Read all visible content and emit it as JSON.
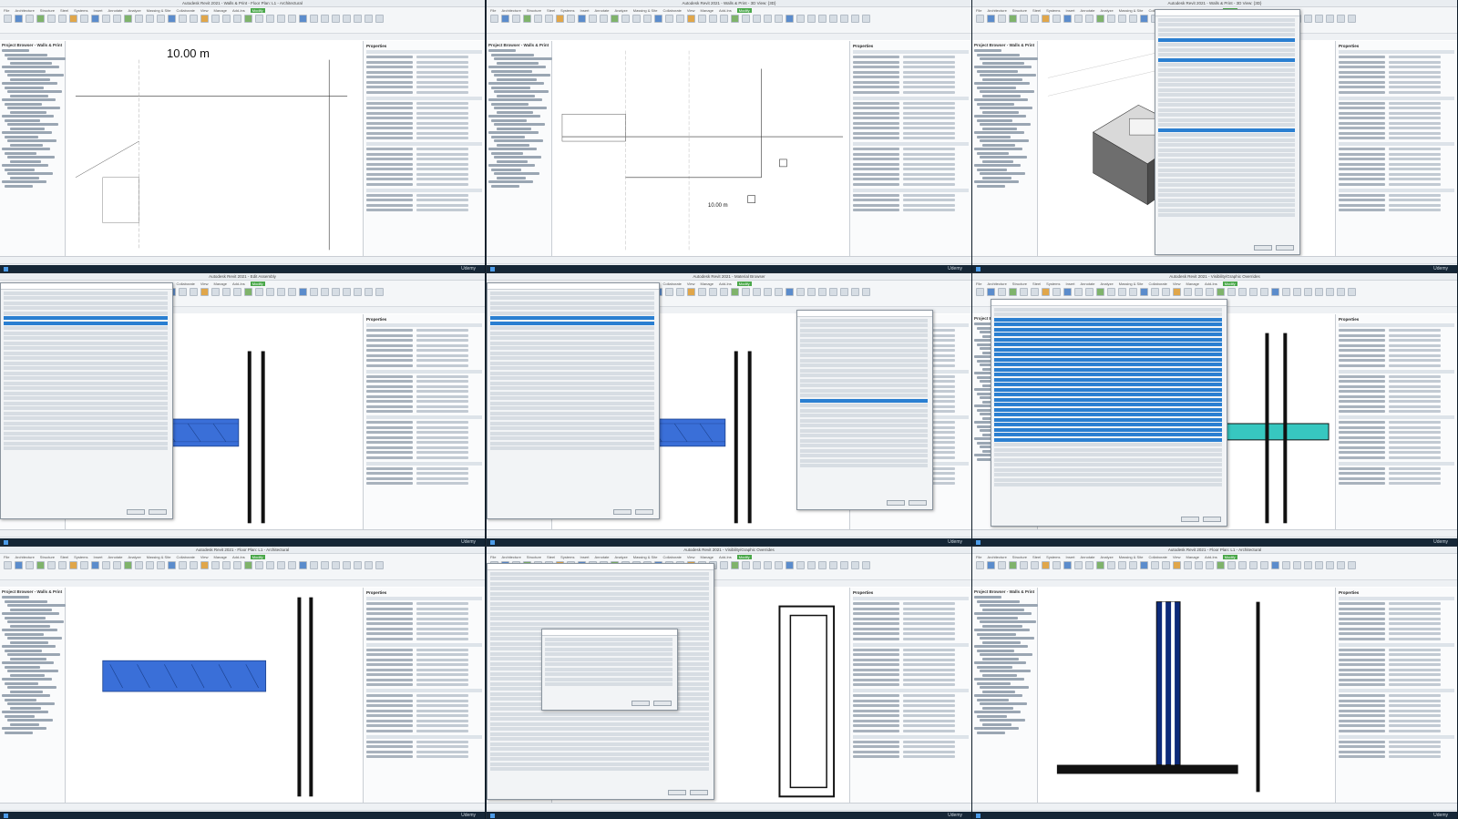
{
  "grid": {
    "cells": [
      {
        "title": "Autodesk Revit 2021 - Walls & Print - Floor Plan: L1 - Architectural",
        "dimension": "10.00 m",
        "kind": "plan-dimension"
      },
      {
        "title": "Autodesk Revit 2021 - Walls & Print - 3D View: {3D}",
        "dimension": "10.00 m",
        "kind": "plan-detail"
      },
      {
        "title": "Autodesk Revit 2021 - Walls & Print - 3D View: {3D}",
        "dimension": "",
        "kind": "3d-box"
      },
      {
        "title": "Autodesk Revit 2021 - Edit Assembly",
        "dimension": "",
        "kind": "edit-assembly"
      },
      {
        "title": "Autodesk Revit 2021 - Material Browser",
        "dimension": "",
        "kind": "material-browser"
      },
      {
        "title": "Autodesk Revit 2021 - Visibility/Graphic Overrides",
        "dimension": "",
        "kind": "vg-overrides"
      },
      {
        "title": "Autodesk Revit 2021 - Floor Plan: L1 - Architectural",
        "dimension": "",
        "kind": "wall-hatch"
      },
      {
        "title": "Autodesk Revit 2021 - Visibility/Graphic Overrides",
        "dimension": "",
        "kind": "vg-dialog"
      },
      {
        "title": "Autodesk Revit 2021 - Floor Plan: L1 - Architectural",
        "dimension": "",
        "kind": "wall-corner"
      }
    ]
  },
  "ribbon": {
    "tabs": [
      "File",
      "Architecture",
      "Structure",
      "Steel",
      "Systems",
      "Insert",
      "Annotate",
      "Analyze",
      "Massing & Site",
      "Collaborate",
      "View",
      "Manage",
      "Add-Ins",
      "Modify"
    ]
  },
  "panels": {
    "browser_title": "Project Browser - Walls & Print",
    "properties_title": "Properties"
  },
  "taskbar": {
    "app": "Udemy"
  },
  "colors": {
    "accent": "#3a6fd8",
    "ribbon_active": "#4aa84a",
    "taskbar": "#152636"
  }
}
